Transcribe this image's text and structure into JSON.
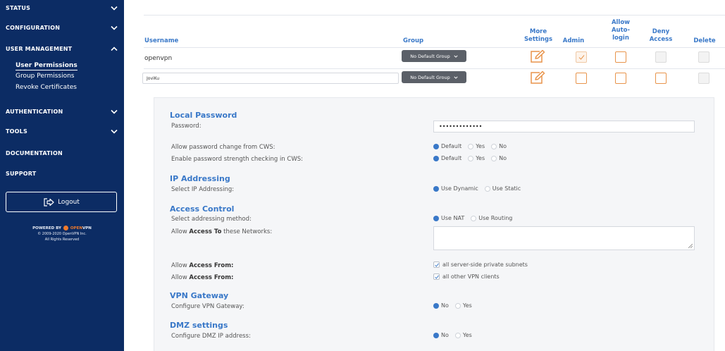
{
  "sidebar": {
    "status": "STATUS",
    "configuration": "CONFIGURATION",
    "user_management": "USER MANAGEMENT",
    "user_permissions": "User Permissions",
    "group_permissions": "Group Permissions",
    "revoke_certificates": "Revoke Certificates",
    "authentication": "AUTHENTICATION",
    "tools": "TOOLS",
    "documentation": "DOCUMENTATION",
    "support": "SUPPORT",
    "logout": "Logout",
    "powered_by": "POWERED BY",
    "brand_open": "OPEN",
    "brand_vpn": "VPN",
    "copyright": "© 2009-2020 OpenVPN Inc.",
    "rights": "All Rights Reserved"
  },
  "table": {
    "headers": {
      "username": "Username",
      "group": "Group",
      "more_settings_1": "More",
      "more_settings_2": "Settings",
      "admin": "Admin",
      "allow_1": "Allow",
      "allow_2": "Auto-",
      "allow_3": "login",
      "deny_1": "Deny",
      "deny_2": "Access",
      "delete": "Delete"
    },
    "rows": [
      {
        "username": "openvpn",
        "group": "No Default Group"
      },
      {
        "username": "JoviKu",
        "group": "No Default Group"
      }
    ]
  },
  "settings": {
    "local_password": {
      "title": "Local Password",
      "password_label": "Password:",
      "password_value": "•••••••••••••",
      "allow_change_label": "Allow password change from CWS:",
      "strength_label": "Enable password strength checking in CWS:",
      "opt_default": "Default",
      "opt_yes": "Yes",
      "opt_no": "No"
    },
    "ip_addressing": {
      "title": "IP Addressing",
      "label": "Select IP Addressing:",
      "opt_dynamic": "Use Dynamic",
      "opt_static": "Use Static"
    },
    "access_control": {
      "title": "Access Control",
      "method_label": "Select addressing method:",
      "opt_nat": "Use NAT",
      "opt_routing": "Use Routing",
      "networks_prefix": "Allow ",
      "networks_bold": "Access To",
      "networks_suffix": " these Networks:",
      "from_prefix": "Allow ",
      "from_bold": "Access From:",
      "from_private": "all server-side private subnets",
      "from_vpn": "all other VPN clients"
    },
    "vpn_gateway": {
      "title": "VPN Gateway",
      "label": "Configure VPN Gateway:",
      "opt_no": "No",
      "opt_yes": "Yes"
    },
    "dmz": {
      "title": "DMZ settings",
      "label": "Configure DMZ IP address:",
      "opt_no": "No",
      "opt_yes": "Yes"
    }
  }
}
